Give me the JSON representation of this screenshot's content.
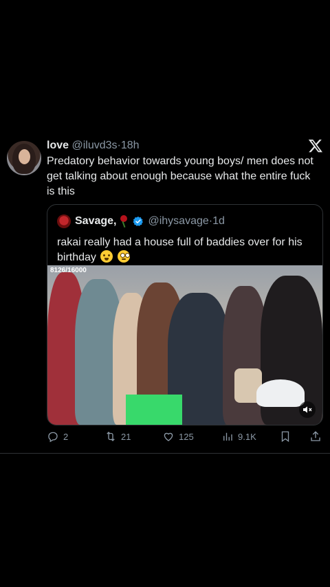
{
  "tweet": {
    "author_name": "love",
    "author_handle": "@iluvd3s",
    "sep": "·",
    "time": "18h",
    "text": "Predatory behavior towards young boys/ men does not get talking about enough because what the entire fuck is this"
  },
  "quote": {
    "author_name": "Savage,",
    "author_handle": "@ihysavage",
    "sep": "·",
    "time": "1d",
    "text": "rakai really had a house full of baddies over for his birthday",
    "media_counter": "8126/16000"
  },
  "actions": {
    "replies": "2",
    "reposts": "21",
    "likes": "125",
    "views": "9.1K"
  },
  "colors": {
    "background": "#000000",
    "text": "#e7e9ea",
    "secondary": "#8b98a5",
    "verified": "#1d9bf0",
    "border": "#2f3336"
  }
}
